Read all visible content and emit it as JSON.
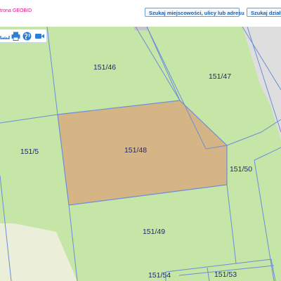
{
  "header": {
    "brand_text": "trona GEOBID",
    "search_place_label": "Szukaj miejscowości, ulicy lub adresu",
    "search_parcel_label": "Szukaj działki"
  },
  "toolbar": {
    "tools": [
      {
        "name": "measure-icon"
      },
      {
        "name": "print-icon"
      },
      {
        "name": "globe-icon"
      },
      {
        "name": "camera-icon"
      }
    ]
  },
  "map": {
    "parcels": [
      {
        "id": "151/46",
        "label": "151/46",
        "selected": false
      },
      {
        "id": "151/47",
        "label": "151/47",
        "selected": false
      },
      {
        "id": "151/48",
        "label": "151/48",
        "selected": true
      },
      {
        "id": "151/5",
        "label": "151/5",
        "selected": false
      },
      {
        "id": "151/50",
        "label": "151/50",
        "selected": false
      },
      {
        "id": "151/49",
        "label": "151/49",
        "selected": false
      },
      {
        "id": "151/54",
        "label": "151/54",
        "selected": false
      },
      {
        "id": "151/53",
        "label": "151/53",
        "selected": false
      }
    ]
  },
  "colors": {
    "parcel_fill": "#c5e6a6",
    "selected_fill": "#d5b585",
    "boundary": "#6c8dd8",
    "road": "#dedede",
    "pale_area": "#ebefd9",
    "label": "#1f2a6b",
    "accent": "#e0118a"
  }
}
